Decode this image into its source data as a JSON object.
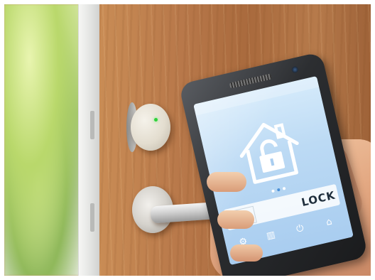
{
  "screen": {
    "bar": {
      "seg1": "",
      "seg2": "",
      "lock_label": "LOCK"
    }
  },
  "colors": {
    "screen_bg": "#bcdaf4",
    "led": "#2fd13b",
    "bar_seg2": "#8ed14b"
  },
  "icons": {
    "house": "house-lock-icon",
    "settings": "gear-icon",
    "stats": "chart-icon",
    "power": "power-icon",
    "home": "home-icon"
  }
}
